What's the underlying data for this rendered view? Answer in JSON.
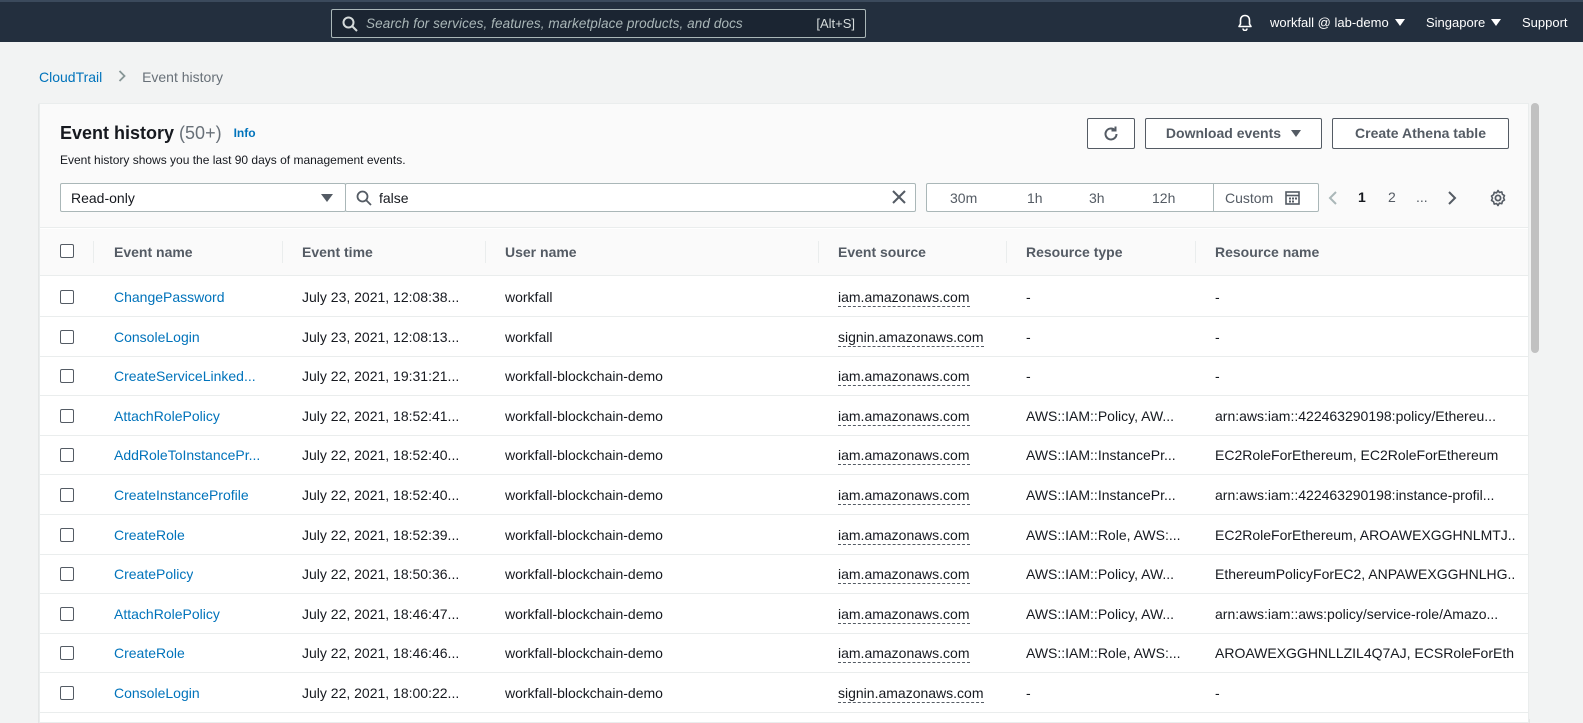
{
  "topnav": {
    "search_placeholder": "Search for services, features, marketplace products, and docs",
    "search_shortcut": "[Alt+S]",
    "account": "workfall @ lab-demo",
    "region": "Singapore",
    "support": "Support"
  },
  "breadcrumb": {
    "root": "CloudTrail",
    "current": "Event history"
  },
  "header": {
    "title": "Event history",
    "count": "(50+)",
    "info": "Info",
    "description": "Event history shows you the last 90 days of management events.",
    "download_label": "Download events",
    "athena_label": "Create Athena table"
  },
  "filter": {
    "attribute": "Read-only",
    "value": "false"
  },
  "time_range": {
    "options": [
      "30m",
      "1h",
      "3h",
      "12h"
    ],
    "custom": "Custom"
  },
  "pagination": {
    "pages": [
      "1",
      "2"
    ],
    "ellipsis": "...",
    "current": "1"
  },
  "table": {
    "columns": [
      "Event name",
      "Event time",
      "User name",
      "Event source",
      "Resource type",
      "Resource name"
    ],
    "rows": [
      {
        "event_name": "ChangePassword",
        "event_time": "July 23, 2021, 12:08:38...",
        "user_name": "workfall",
        "event_source": "iam.amazonaws.com",
        "resource_type": "-",
        "resource_name": "-"
      },
      {
        "event_name": "ConsoleLogin",
        "event_time": "July 23, 2021, 12:08:13...",
        "user_name": "workfall",
        "event_source": "signin.amazonaws.com",
        "resource_type": "-",
        "resource_name": "-"
      },
      {
        "event_name": "CreateServiceLinked...",
        "event_time": "July 22, 2021, 19:31:21...",
        "user_name": "workfall-blockchain-demo",
        "event_source": "iam.amazonaws.com",
        "resource_type": "-",
        "resource_name": "-"
      },
      {
        "event_name": "AttachRolePolicy",
        "event_time": "July 22, 2021, 18:52:41...",
        "user_name": "workfall-blockchain-demo",
        "event_source": "iam.amazonaws.com",
        "resource_type": "AWS::IAM::Policy, AW...",
        "resource_name": "arn:aws:iam::422463290198:policy/Ethereu..."
      },
      {
        "event_name": "AddRoleToInstancePr...",
        "event_time": "July 22, 2021, 18:52:40...",
        "user_name": "workfall-blockchain-demo",
        "event_source": "iam.amazonaws.com",
        "resource_type": "AWS::IAM::InstancePr...",
        "resource_name": "EC2RoleForEthereum, EC2RoleForEthereum"
      },
      {
        "event_name": "CreateInstanceProfile",
        "event_time": "July 22, 2021, 18:52:40...",
        "user_name": "workfall-blockchain-demo",
        "event_source": "iam.amazonaws.com",
        "resource_type": "AWS::IAM::InstancePr...",
        "resource_name": "arn:aws:iam::422463290198:instance-profil..."
      },
      {
        "event_name": "CreateRole",
        "event_time": "July 22, 2021, 18:52:39...",
        "user_name": "workfall-blockchain-demo",
        "event_source": "iam.amazonaws.com",
        "resource_type": "AWS::IAM::Role, AWS:...",
        "resource_name": "EC2RoleForEthereum, AROAWEXGGHNLMTJ..."
      },
      {
        "event_name": "CreatePolicy",
        "event_time": "July 22, 2021, 18:50:36...",
        "user_name": "workfall-blockchain-demo",
        "event_source": "iam.amazonaws.com",
        "resource_type": "AWS::IAM::Policy, AW...",
        "resource_name": "EthereumPolicyForEC2, ANPAWEXGGHNLHG..."
      },
      {
        "event_name": "AttachRolePolicy",
        "event_time": "July 22, 2021, 18:46:47...",
        "user_name": "workfall-blockchain-demo",
        "event_source": "iam.amazonaws.com",
        "resource_type": "AWS::IAM::Policy, AW...",
        "resource_name": "arn:aws:iam::aws:policy/service-role/Amazo..."
      },
      {
        "event_name": "CreateRole",
        "event_time": "July 22, 2021, 18:46:46...",
        "user_name": "workfall-blockchain-demo",
        "event_source": "iam.amazonaws.com",
        "resource_type": "AWS::IAM::Role, AWS:...",
        "resource_name": "AROAWEXGGHNLLZIL4Q7AJ, ECSRoleForEth..."
      },
      {
        "event_name": "ConsoleLogin",
        "event_time": "July 22, 2021, 18:00:22...",
        "user_name": "workfall-blockchain-demo",
        "event_source": "signin.amazonaws.com",
        "resource_type": "-",
        "resource_name": "-"
      }
    ]
  },
  "colors": {
    "nav_bg": "#232f3e",
    "link": "#0073bb",
    "page_bg": "#f2f3f3"
  }
}
